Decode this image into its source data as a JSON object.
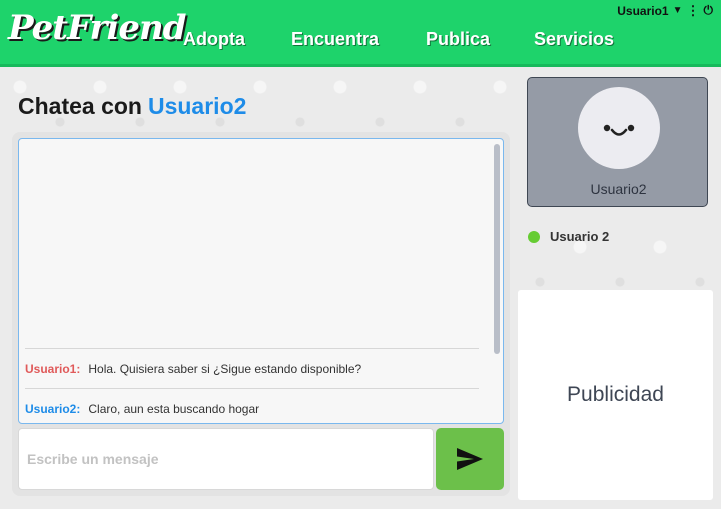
{
  "header": {
    "logo": "PetFriend",
    "nav": [
      "Adopta",
      "Encuentra",
      "Publica",
      "Servicios"
    ],
    "user": "Usuario1",
    "caret_icon": "▼",
    "kebab_icon": "⋮",
    "power_icon": "⏻"
  },
  "chat": {
    "title_prefix": "Chatea con",
    "title_user": "Usuario2",
    "messages": [
      {
        "author": "Usuario1:",
        "text": "Hola. Quisiera saber si ¿Sigue estando disponible?",
        "color": "#e05a5a"
      },
      {
        "author": "Usuario2:",
        "text": "Claro, aun esta buscando hogar",
        "color": "#1e8ce8"
      }
    ],
    "input_placeholder": "Escribe un mensaje",
    "send_icon": "send-icon"
  },
  "profile": {
    "name": "Usuario2",
    "status_label": "Usuario 2",
    "status_color": "#66cc33"
  },
  "ad": {
    "label": "Publicidad"
  },
  "colors": {
    "brand": "#1ed36b",
    "send": "#6cc04a",
    "accent": "#1e8ce8"
  }
}
